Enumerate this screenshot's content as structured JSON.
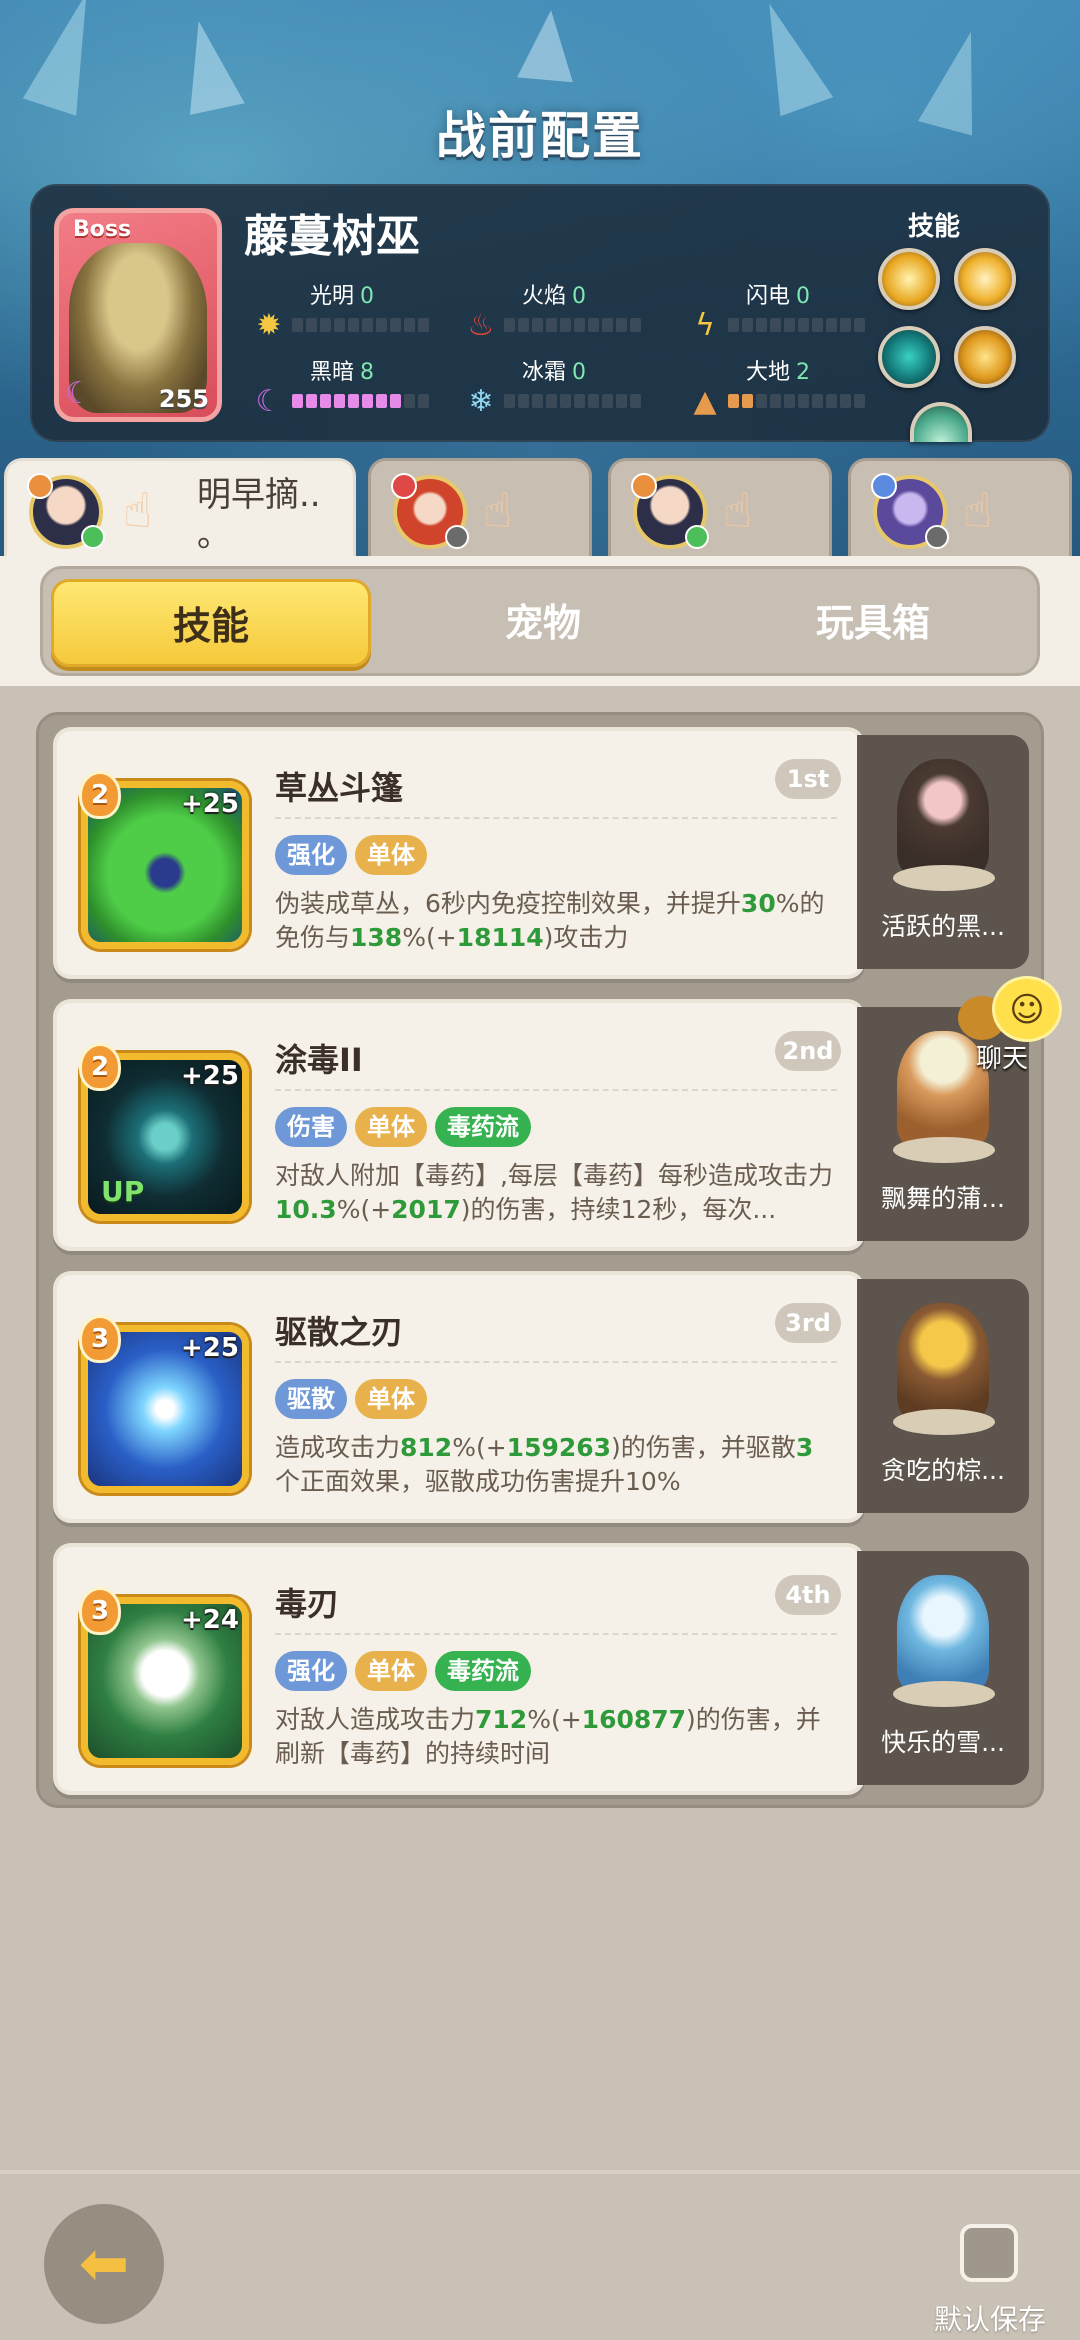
{
  "header": {
    "title": "战前配置"
  },
  "boss": {
    "tag": "Boss",
    "name": "藤蔓树巫",
    "level": "255",
    "elements": [
      {
        "name": "光明",
        "value": "0",
        "icon": "sun-icon"
      },
      {
        "name": "火焰",
        "value": "0",
        "icon": "fire-icon"
      },
      {
        "name": "闪电",
        "value": "0",
        "icon": "lightning-icon"
      },
      {
        "name": "黑暗",
        "value": "8",
        "icon": "moon-icon"
      },
      {
        "name": "冰霜",
        "value": "0",
        "icon": "snowflake-icon"
      },
      {
        "name": "大地",
        "value": "2",
        "icon": "mountain-icon"
      }
    ],
    "skills_label": "技能"
  },
  "heroes": [
    {
      "name": "明早摘..\n。",
      "status": "online"
    },
    {
      "name": "",
      "status": "offline"
    },
    {
      "name": "",
      "status": "online"
    },
    {
      "name": "",
      "status": "offline"
    }
  ],
  "tabs": [
    "技能",
    "宠物",
    "玩具箱"
  ],
  "skills": [
    {
      "title": "草丛斗篷",
      "rank": "1st",
      "level": "2",
      "plus": "+25",
      "tags": [
        "强化",
        "单体"
      ],
      "desc_parts": [
        "伪装成草丛，6秒内免疫控制效果，并提升",
        "30",
        "%的免伤与",
        "138",
        "%(+",
        "18114",
        ")攻击力"
      ]
    },
    {
      "title": "涂毒II",
      "rank": "2nd",
      "level": "2",
      "plus": "+25",
      "up": "UP",
      "tags": [
        "伤害",
        "单体",
        "毒药流"
      ],
      "desc_parts": [
        "对敌人附加【毒药】,每层【毒药】每秒造成攻击力",
        "10.3",
        "%(+",
        "2017",
        ")的伤害，持续12秒，每次..."
      ]
    },
    {
      "title": "驱散之刃",
      "rank": "3rd",
      "level": "3",
      "plus": "+25",
      "tags": [
        "驱散",
        "单体"
      ],
      "desc_parts": [
        "造成攻击力",
        "812",
        "%(+",
        "159263",
        ")的伤害，并驱散",
        "3",
        "个正面效果，驱散成功伤害提升10%"
      ]
    },
    {
      "title": "毒刃",
      "rank": "4th",
      "level": "3",
      "plus": "+24",
      "tags": [
        "强化",
        "单体",
        "毒药流"
      ],
      "desc_parts": [
        "对敌人造成攻击力",
        "712",
        "%(+",
        "160877",
        ")的伤害，并刷新【毒药】的持续时间"
      ]
    }
  ],
  "pets": [
    "活跃的黑...",
    "飘舞的蒲...",
    "贪吃的棕...",
    "快乐的雪..."
  ],
  "chat": {
    "label": "聊天"
  },
  "footer": {
    "save_label": "默认保存"
  },
  "colors": {
    "accent_yellow": "#f5c93b",
    "highlight_green": "#2f9a3a",
    "tag_blue": "#6f98d8",
    "tag_orange": "#e8b14c",
    "tag_green": "#37b250"
  }
}
